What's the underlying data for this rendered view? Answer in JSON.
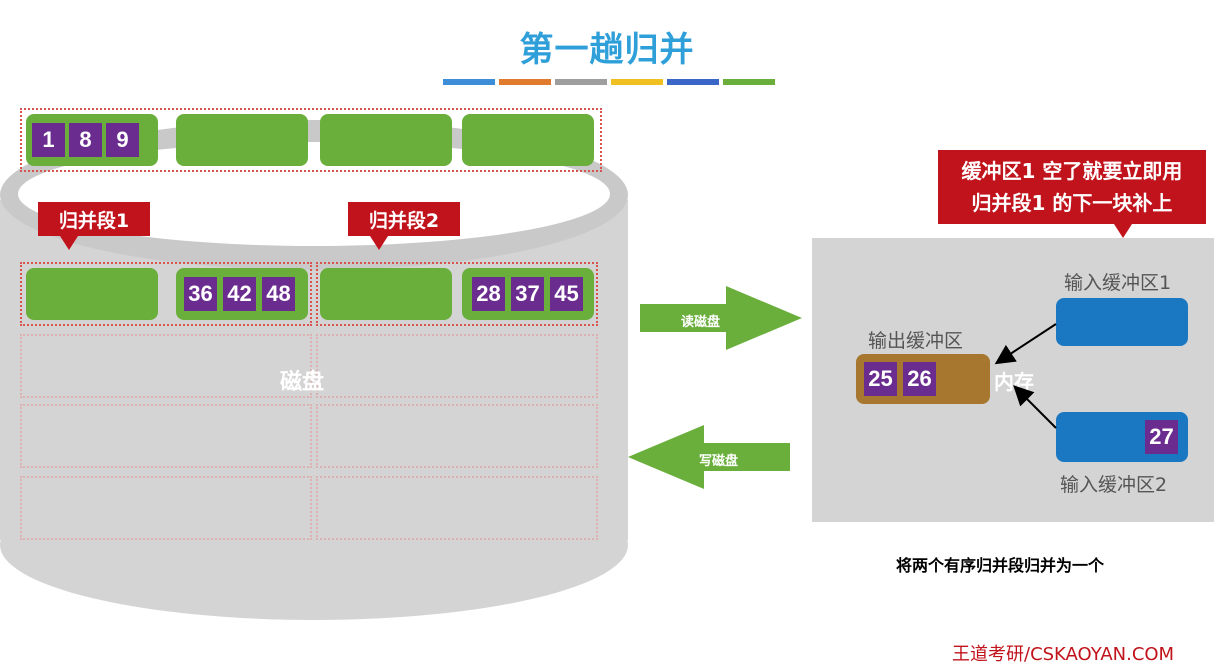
{
  "title": "第一趟归并",
  "strip_colors": [
    "#3d8ed8",
    "#e07b2e",
    "#9e9e9e",
    "#f0c020",
    "#3a66c8",
    "#6aaf3c"
  ],
  "top_block_values": [
    "1",
    "8",
    "9"
  ],
  "segments": {
    "seg1_label": "归并段1",
    "seg2_label": "归并段2",
    "seg1_values": [
      "36",
      "42",
      "48"
    ],
    "seg2_values": [
      "28",
      "37",
      "45"
    ]
  },
  "disk_label": "磁盘",
  "arrows": {
    "read_label": "读磁盘",
    "write_label": "写磁盘"
  },
  "callout": {
    "line1": "缓冲区1 空了就要立即用",
    "line2": "归并段1 的下一块补上"
  },
  "memory": {
    "label": "内存",
    "input1_label": "输入缓冲区1",
    "input2_label": "输入缓冲区2",
    "output_label": "输出缓冲区",
    "output_values": [
      "25",
      "26"
    ],
    "input2_value": "27"
  },
  "caption": "将两个有序归并段归并为一个",
  "footer": "王道考研/CSKAOYAN.COM",
  "colors": {
    "title": "#2e9fd9",
    "block_green": "#6aaf3c",
    "record_purple": "#6a2d8f",
    "callout_red": "#c1131c",
    "buffer_blue": "#1a78c2",
    "output_brown": "#a8772f"
  }
}
